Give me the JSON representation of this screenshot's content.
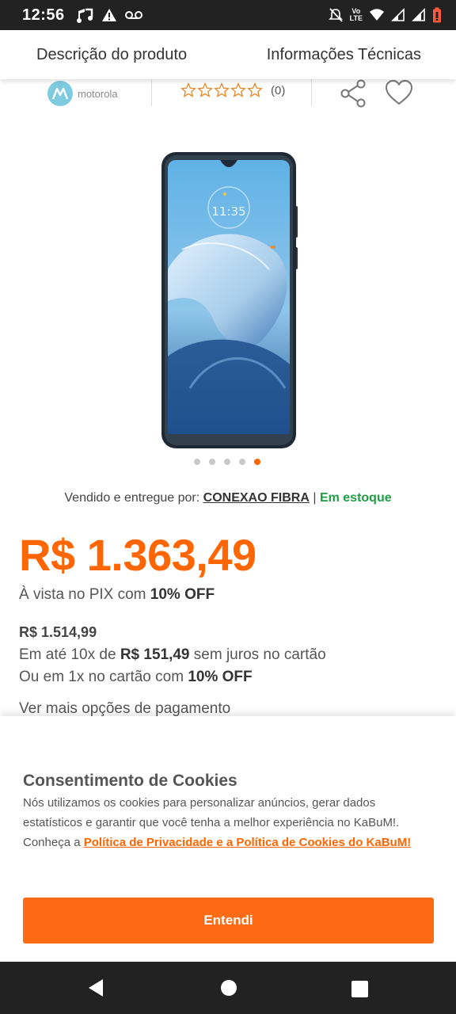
{
  "status_bar": {
    "time": "12:56",
    "left_icons": [
      "music-note-icon",
      "alert-triangle-icon",
      "voicemail-icon"
    ],
    "volte_label_top": "Vo",
    "volte_label_bottom": "LTE",
    "right_icons": [
      "notifications-off-icon",
      "volte-icon",
      "wifi-icon",
      "signal-icon",
      "signal-icon",
      "battery-icon"
    ]
  },
  "tabs": {
    "description": "Descrição do produto",
    "technical": "Informações Técnicas"
  },
  "product": {
    "brand": "motorola",
    "rating_count": "(0)",
    "stars_filled": 0,
    "stars_total": 5,
    "image_count": 5,
    "active_image": 5
  },
  "seller": {
    "prefix": "Vendido e entregue por:",
    "name": "CONEXAO FIBRA",
    "separator": "|",
    "stock": "Em estoque"
  },
  "pricing": {
    "pix_price": "R$ 1.363,49",
    "pix_prefix": "À vista no PIX com",
    "pix_discount": "10% OFF",
    "card_price": "R$ 1.514,99",
    "installments_prefix": "Em até 10x de",
    "installment_value": "R$ 151,49",
    "installments_suffix": "sem juros no cartão",
    "one_x_prefix": "Ou em 1x no cartão com",
    "one_x_discount": "10% OFF",
    "more_options": "Ver mais opções de pagamento"
  },
  "cookie_consent": {
    "title": "Consentimento de Cookies",
    "text": "Nós utilizamos os cookies para personalizar anúncios, gerar dados estatísticos e garantir que você tenha a melhor experiência no KaBuM!. Conheça a",
    "link": "Política de Privacidade e a Política de Cookies do KaBuM!",
    "button": "Entendi"
  },
  "colors": {
    "accent": "#ff6500",
    "stock_green": "#1e9e43",
    "bar_dark": "#222222"
  },
  "nav_bar": {
    "icons": [
      "back-icon",
      "home-icon",
      "recents-icon"
    ]
  }
}
